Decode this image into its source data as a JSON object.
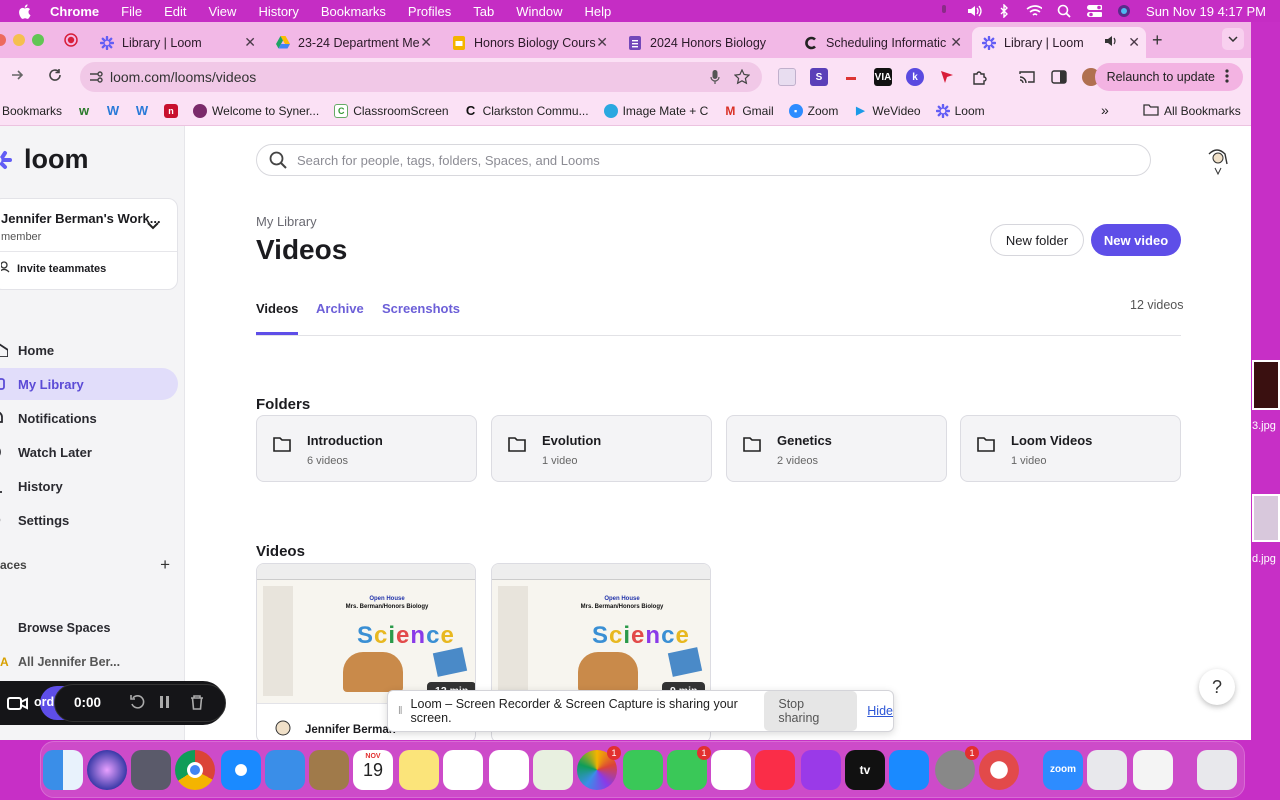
{
  "menubar": {
    "app": "Chrome",
    "items": [
      "File",
      "Edit",
      "View",
      "History",
      "Bookmarks",
      "Profiles",
      "Tab",
      "Window",
      "Help"
    ],
    "clock": "Sun Nov 19  4:17 PM"
  },
  "tabs": [
    {
      "title": "Library | Loom",
      "active": false
    },
    {
      "title": "23-24 Department Me",
      "active": false
    },
    {
      "title": "Honors Biology Cours",
      "active": false
    },
    {
      "title": "2024 Honors Biology",
      "active": false
    },
    {
      "title": "Scheduling Informatic",
      "active": false
    },
    {
      "title": "Library | Loom",
      "active": true
    }
  ],
  "address": {
    "url": "loom.com/looms/videos",
    "relaunch": "Relaunch to update"
  },
  "bookmarks": {
    "label": "Bookmarks",
    "items": [
      "Welcome to Syner...",
      "ClassroomScreen",
      "Clarkston Commu...",
      "Image Mate + C",
      "Gmail",
      "Zoom",
      "WeVideo",
      "Loom"
    ],
    "all": "All Bookmarks"
  },
  "sidebar": {
    "logo": "loom",
    "workspace_name": "Jennifer Berman's Work...",
    "workspace_role": "member",
    "invite": "Invite teammates",
    "nav": [
      {
        "label": "Home",
        "icon": "home-icon"
      },
      {
        "label": "My Library",
        "icon": "library-icon",
        "active": true
      },
      {
        "label": "Notifications",
        "icon": "bell-icon"
      },
      {
        "label": "Watch Later",
        "icon": "clock-icon"
      },
      {
        "label": "History",
        "icon": "history-icon"
      },
      {
        "label": "Settings",
        "icon": "gear-icon"
      }
    ],
    "spaces_header": "aces",
    "spaces": [
      {
        "label": "Browse Spaces"
      },
      {
        "label": "All Jennifer Ber..."
      }
    ]
  },
  "main": {
    "search_placeholder": "Search for people, tags, folders, Spaces, and Looms",
    "breadcrumb": "My Library",
    "title": "Videos",
    "new_folder": "New folder",
    "new_video": "New video",
    "tabs": [
      "Videos",
      "Archive",
      "Screenshots"
    ],
    "video_count": "12 videos",
    "folders_heading": "Folders",
    "folders": [
      {
        "name": "Introduction",
        "count": "6 videos"
      },
      {
        "name": "Evolution",
        "count": "1 video"
      },
      {
        "name": "Genetics",
        "count": "2 videos"
      },
      {
        "name": "Loom Videos",
        "count": "1 video"
      }
    ],
    "videos_heading": "Videos",
    "videos": [
      {
        "slide_title": "Open House",
        "slide_sub": "Mrs. Berman/Honors Biology",
        "word": "Science",
        "duration": "12 min",
        "owner": "Jennifer Berman"
      },
      {
        "slide_title": "Open House",
        "slide_sub": "Mrs. Berman/Honors Biology",
        "word": "Science",
        "duration": "9 min",
        "owner": ""
      }
    ]
  },
  "recorder": {
    "time": "0:00",
    "label": "ord"
  },
  "share_bar": {
    "text": "Loom – Screen Recorder & Screen Capture is sharing your screen.",
    "stop": "Stop sharing",
    "hide": "Hide"
  },
  "desktop": {
    "file1": "3.jpg",
    "file2": "d.jpg"
  },
  "dock": {
    "calendar_month": "NOV",
    "calendar_day": "19",
    "badges": {
      "photos": "1",
      "facetime": "1",
      "settings": "1"
    },
    "appletv": "tv",
    "zoom": "zoom"
  },
  "colors": {
    "accent": "#5e4ee8",
    "tabstrip": "#f2b8e6",
    "desktop": "#c72fc6"
  }
}
